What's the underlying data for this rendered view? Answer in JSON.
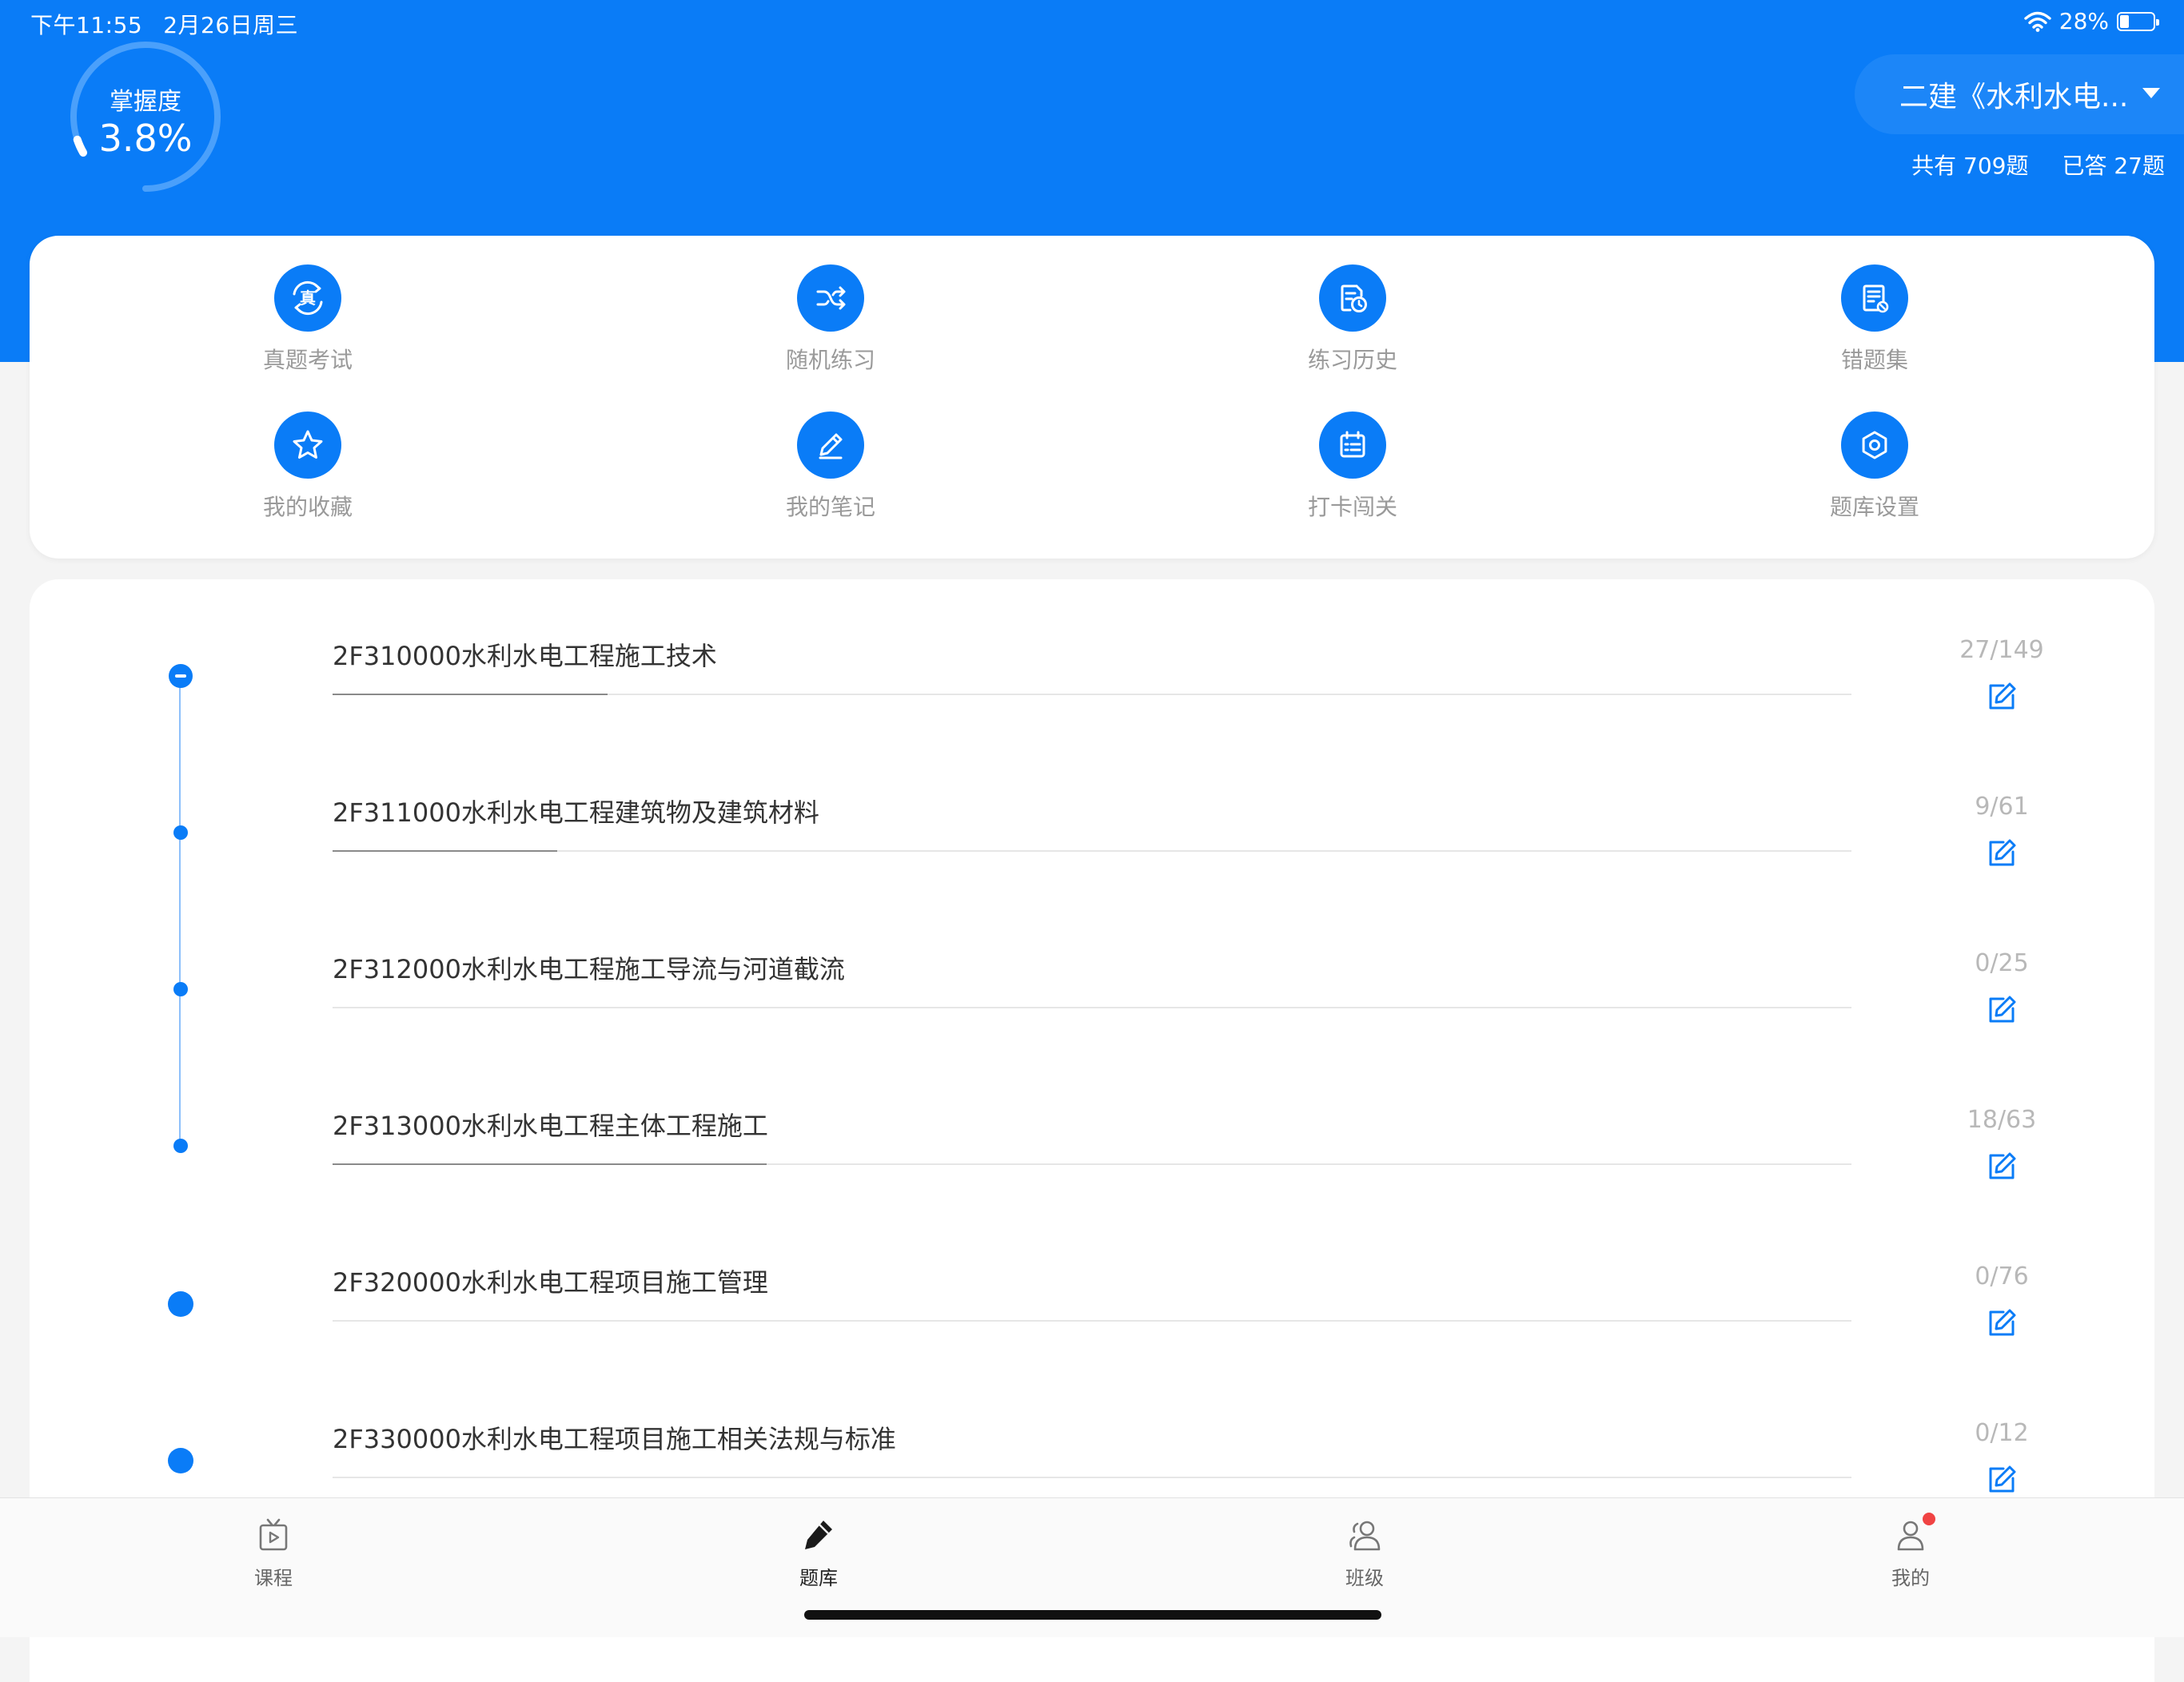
{
  "status_bar": {
    "time": "下午11:55",
    "date": "2月26日周三",
    "battery_text": "28%",
    "battery_level": 0.28
  },
  "mastery": {
    "label": "掌握度",
    "value": "3.8%",
    "level": 0.038
  },
  "subject": {
    "title": "二建《水利水电...",
    "total": "共有 709题",
    "answered": "已答 27题"
  },
  "actions": [
    {
      "label": "真题考试",
      "icon": "real-exam-icon"
    },
    {
      "label": "随机练习",
      "icon": "shuffle-icon"
    },
    {
      "label": "练习历史",
      "icon": "history-icon"
    },
    {
      "label": "错题集",
      "icon": "mistakes-icon"
    },
    {
      "label": "我的收藏",
      "icon": "star-icon"
    },
    {
      "label": "我的笔记",
      "icon": "pencil-icon"
    },
    {
      "label": "打卡闯关",
      "icon": "calendar-icon"
    },
    {
      "label": "题库设置",
      "icon": "settings-icon"
    }
  ],
  "chapters": [
    {
      "title": "2F310000水利水电工程施工技术",
      "count": "27/149",
      "progress": 0.181
    },
    {
      "title": "2F311000水利水电工程建筑物及建筑材料",
      "count": "9/61",
      "progress": 0.148
    },
    {
      "title": "2F312000水利水电工程施工导流与河道截流",
      "count": "0/25",
      "progress": 0
    },
    {
      "title": "2F313000水利水电工程主体工程施工",
      "count": "18/63",
      "progress": 0.286
    },
    {
      "title": "2F320000水利水电工程项目施工管理",
      "count": "0/76",
      "progress": 0
    },
    {
      "title": "2F330000水利水电工程项目施工相关法规与标准",
      "count": "0/12",
      "progress": 0
    }
  ],
  "tabs": [
    {
      "label": "课程",
      "icon": "tv-icon"
    },
    {
      "label": "题库",
      "icon": "pencil-tab-icon"
    },
    {
      "label": "班级",
      "icon": "class-icon"
    },
    {
      "label": "我的",
      "icon": "person-icon"
    }
  ],
  "colors": {
    "brand": "#0a7cf7",
    "badge": "#f04343"
  }
}
